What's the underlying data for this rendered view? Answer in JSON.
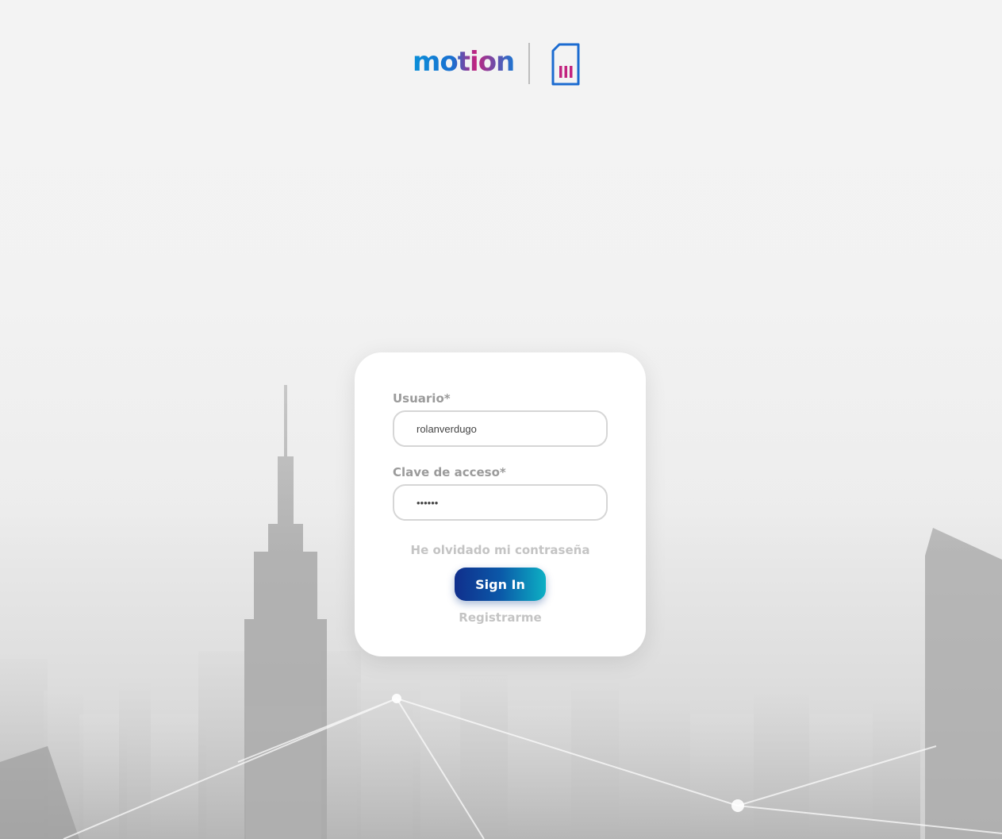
{
  "header": {
    "logo_text": "motion",
    "brand_icon": "sim-card-icon"
  },
  "login": {
    "username_label": "Usuario*",
    "username_value": "rolanverdugo",
    "password_label": "Clave de acceso*",
    "password_value": "••••••",
    "forgot_link": "He olvidado mi contraseña",
    "signin_button": "Sign In",
    "register_link": "Registrarme"
  },
  "colors": {
    "button_start": "#102f8c",
    "button_end": "#0db0c4",
    "sim_icon_stroke": "#1b6bd0",
    "sim_icon_bars": "#c2237f",
    "label": "#9b9b9b",
    "link": "#c4c4c4"
  }
}
